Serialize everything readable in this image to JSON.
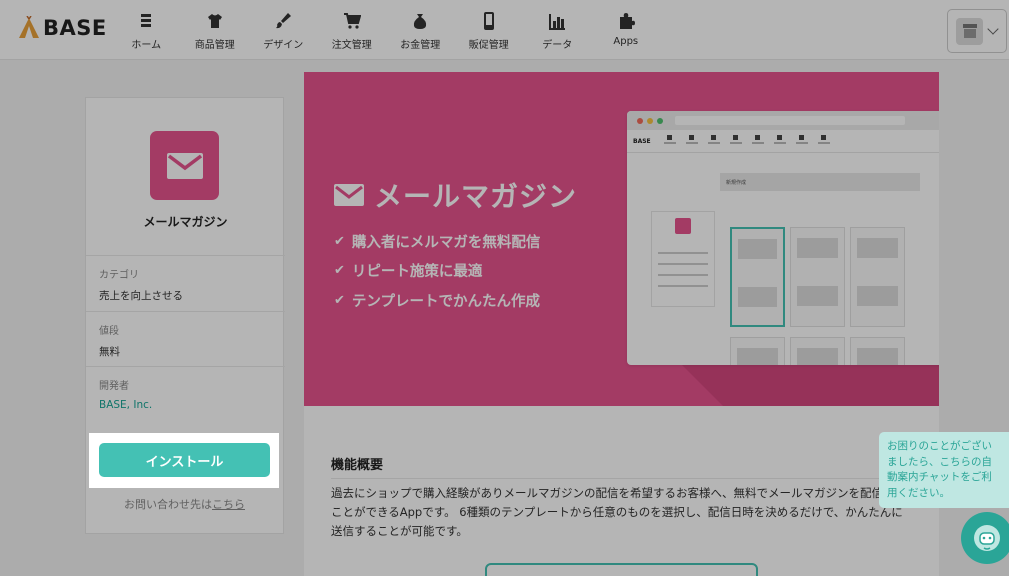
{
  "header": {
    "logo_text": "BASE",
    "nav": [
      {
        "label": "ホーム",
        "icon": "home-icon"
      },
      {
        "label": "商品管理",
        "icon": "tshirt-icon"
      },
      {
        "label": "デザイン",
        "icon": "brush-icon"
      },
      {
        "label": "注文管理",
        "icon": "cart-icon"
      },
      {
        "label": "お金管理",
        "icon": "money-bag-icon"
      },
      {
        "label": "販促管理",
        "icon": "smartphone-icon"
      },
      {
        "label": "データ",
        "icon": "bar-chart-icon"
      },
      {
        "label": "Apps",
        "icon": "puzzle-icon"
      }
    ],
    "shop_menu_icon": "store-icon"
  },
  "sidebar": {
    "app_name": "メールマガジン",
    "app_icon": "mail-icon",
    "category_label": "カテゴリ",
    "category_value": "売上を向上させる",
    "price_label": "値段",
    "price_value": "無料",
    "developer_label": "開発者",
    "developer_value": "BASE, Inc.",
    "install_label": "インストール",
    "contact_text": "お問い合わせ先は",
    "contact_link": "こちら"
  },
  "hero": {
    "title": "メールマガジン",
    "features": [
      "購入者にメルマガを無料配信",
      "リピート施策に最適",
      "テンプレートでかんたん作成"
    ],
    "mock_header": "新規作成"
  },
  "overview": {
    "title": "機能概要",
    "description": "過去にショップで購入経験がありメールマガジンの配信を希望するお客様へ、無料でメールマガジンを配信することができるAppです。 6種類のテンプレートから任意のものを選択し、配信日時を決めるだけで、かんたんに送信することが可能です。"
  },
  "chat": {
    "message": "お困りのことがございましたら、こちらの自動案内チャットをご利用ください。"
  },
  "colors": {
    "accent": "#44c1b4",
    "hero_pink": "#e6538e",
    "link_green": "#19a596"
  }
}
